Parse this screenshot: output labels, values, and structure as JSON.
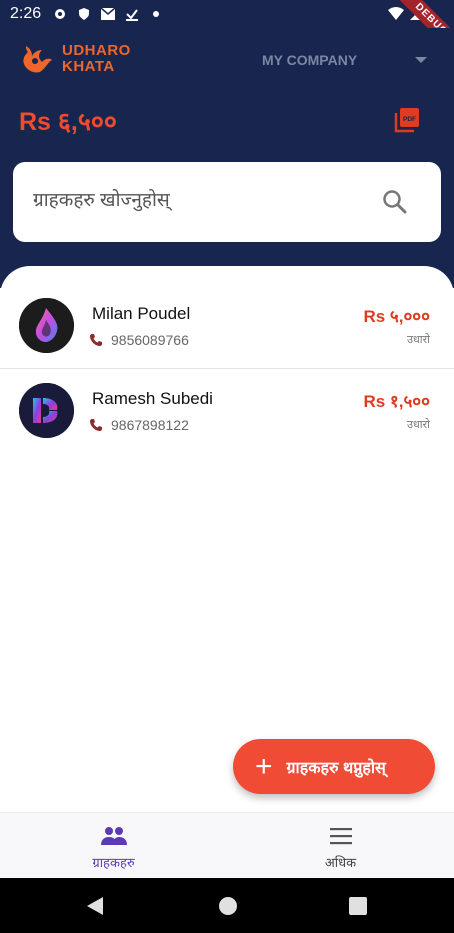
{
  "status_bar": {
    "time": "2:26",
    "icons": [
      "gear-icon",
      "shield-icon",
      "mail-icon",
      "check-icon",
      "dot-icon",
      "wifi-icon",
      "signal-icon",
      "battery-icon"
    ]
  },
  "debug_banner": "DEBUG",
  "header": {
    "logo_line1": "UDHARO",
    "logo_line2": "KHATA",
    "company_name": "MY COMPANY",
    "total_amount": "Rs ६,५००",
    "pdf_icon": "pdf-icon"
  },
  "search": {
    "placeholder": "ग्राहकहरु खोज्नुहोस्"
  },
  "customers": [
    {
      "name": "Milan Poudel",
      "phone": "9856089766",
      "amount": "Rs ५,०००",
      "status": "उधारो"
    },
    {
      "name": "Ramesh Subedi",
      "phone": "9867898122",
      "amount": "Rs १,५००",
      "status": "उधारो"
    }
  ],
  "fab": {
    "label": "ग्राहकहरु थप्नुहोस्"
  },
  "bottom_nav": [
    {
      "label": "ग्राहकहरु",
      "icon": "people-icon",
      "active": true
    },
    {
      "label": "अधिक",
      "icon": "menu-icon",
      "active": false
    }
  ],
  "colors": {
    "header_bg": "#17254f",
    "accent_orange": "#f24a2c",
    "fab_bg": "#ef4b35",
    "nav_active": "#5b3bb5"
  }
}
